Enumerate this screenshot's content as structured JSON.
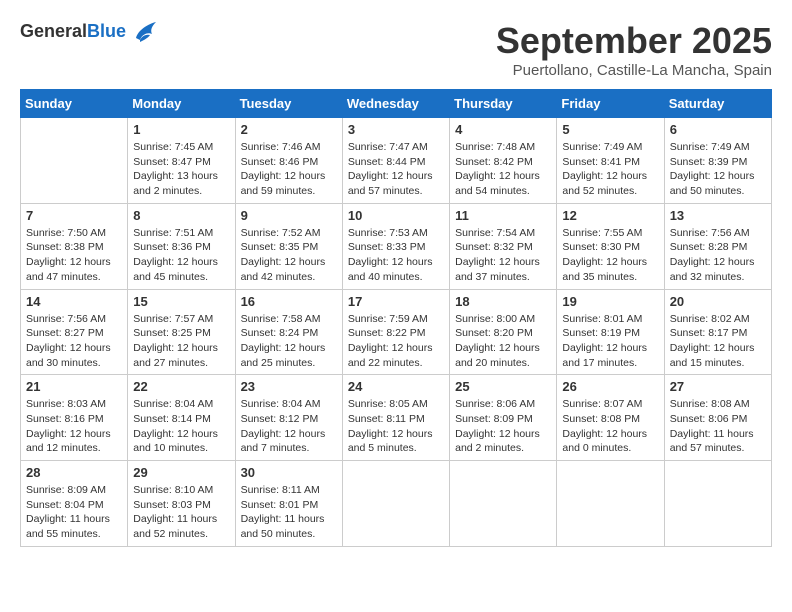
{
  "logo": {
    "general": "General",
    "blue": "Blue",
    "bird_icon": "▶"
  },
  "title": "September 2025",
  "subtitle": "Puertollano, Castille-La Mancha, Spain",
  "days_of_week": [
    "Sunday",
    "Monday",
    "Tuesday",
    "Wednesday",
    "Thursday",
    "Friday",
    "Saturday"
  ],
  "weeks": [
    [
      {
        "day": "",
        "info": ""
      },
      {
        "day": "1",
        "info": "Sunrise: 7:45 AM\nSunset: 8:47 PM\nDaylight: 13 hours\nand 2 minutes."
      },
      {
        "day": "2",
        "info": "Sunrise: 7:46 AM\nSunset: 8:46 PM\nDaylight: 12 hours\nand 59 minutes."
      },
      {
        "day": "3",
        "info": "Sunrise: 7:47 AM\nSunset: 8:44 PM\nDaylight: 12 hours\nand 57 minutes."
      },
      {
        "day": "4",
        "info": "Sunrise: 7:48 AM\nSunset: 8:42 PM\nDaylight: 12 hours\nand 54 minutes."
      },
      {
        "day": "5",
        "info": "Sunrise: 7:49 AM\nSunset: 8:41 PM\nDaylight: 12 hours\nand 52 minutes."
      },
      {
        "day": "6",
        "info": "Sunrise: 7:49 AM\nSunset: 8:39 PM\nDaylight: 12 hours\nand 50 minutes."
      }
    ],
    [
      {
        "day": "7",
        "info": "Sunrise: 7:50 AM\nSunset: 8:38 PM\nDaylight: 12 hours\nand 47 minutes."
      },
      {
        "day": "8",
        "info": "Sunrise: 7:51 AM\nSunset: 8:36 PM\nDaylight: 12 hours\nand 45 minutes."
      },
      {
        "day": "9",
        "info": "Sunrise: 7:52 AM\nSunset: 8:35 PM\nDaylight: 12 hours\nand 42 minutes."
      },
      {
        "day": "10",
        "info": "Sunrise: 7:53 AM\nSunset: 8:33 PM\nDaylight: 12 hours\nand 40 minutes."
      },
      {
        "day": "11",
        "info": "Sunrise: 7:54 AM\nSunset: 8:32 PM\nDaylight: 12 hours\nand 37 minutes."
      },
      {
        "day": "12",
        "info": "Sunrise: 7:55 AM\nSunset: 8:30 PM\nDaylight: 12 hours\nand 35 minutes."
      },
      {
        "day": "13",
        "info": "Sunrise: 7:56 AM\nSunset: 8:28 PM\nDaylight: 12 hours\nand 32 minutes."
      }
    ],
    [
      {
        "day": "14",
        "info": "Sunrise: 7:56 AM\nSunset: 8:27 PM\nDaylight: 12 hours\nand 30 minutes."
      },
      {
        "day": "15",
        "info": "Sunrise: 7:57 AM\nSunset: 8:25 PM\nDaylight: 12 hours\nand 27 minutes."
      },
      {
        "day": "16",
        "info": "Sunrise: 7:58 AM\nSunset: 8:24 PM\nDaylight: 12 hours\nand 25 minutes."
      },
      {
        "day": "17",
        "info": "Sunrise: 7:59 AM\nSunset: 8:22 PM\nDaylight: 12 hours\nand 22 minutes."
      },
      {
        "day": "18",
        "info": "Sunrise: 8:00 AM\nSunset: 8:20 PM\nDaylight: 12 hours\nand 20 minutes."
      },
      {
        "day": "19",
        "info": "Sunrise: 8:01 AM\nSunset: 8:19 PM\nDaylight: 12 hours\nand 17 minutes."
      },
      {
        "day": "20",
        "info": "Sunrise: 8:02 AM\nSunset: 8:17 PM\nDaylight: 12 hours\nand 15 minutes."
      }
    ],
    [
      {
        "day": "21",
        "info": "Sunrise: 8:03 AM\nSunset: 8:16 PM\nDaylight: 12 hours\nand 12 minutes."
      },
      {
        "day": "22",
        "info": "Sunrise: 8:04 AM\nSunset: 8:14 PM\nDaylight: 12 hours\nand 10 minutes."
      },
      {
        "day": "23",
        "info": "Sunrise: 8:04 AM\nSunset: 8:12 PM\nDaylight: 12 hours\nand 7 minutes."
      },
      {
        "day": "24",
        "info": "Sunrise: 8:05 AM\nSunset: 8:11 PM\nDaylight: 12 hours\nand 5 minutes."
      },
      {
        "day": "25",
        "info": "Sunrise: 8:06 AM\nSunset: 8:09 PM\nDaylight: 12 hours\nand 2 minutes."
      },
      {
        "day": "26",
        "info": "Sunrise: 8:07 AM\nSunset: 8:08 PM\nDaylight: 12 hours\nand 0 minutes."
      },
      {
        "day": "27",
        "info": "Sunrise: 8:08 AM\nSunset: 8:06 PM\nDaylight: 11 hours\nand 57 minutes."
      }
    ],
    [
      {
        "day": "28",
        "info": "Sunrise: 8:09 AM\nSunset: 8:04 PM\nDaylight: 11 hours\nand 55 minutes."
      },
      {
        "day": "29",
        "info": "Sunrise: 8:10 AM\nSunset: 8:03 PM\nDaylight: 11 hours\nand 52 minutes."
      },
      {
        "day": "30",
        "info": "Sunrise: 8:11 AM\nSunset: 8:01 PM\nDaylight: 11 hours\nand 50 minutes."
      },
      {
        "day": "",
        "info": ""
      },
      {
        "day": "",
        "info": ""
      },
      {
        "day": "",
        "info": ""
      },
      {
        "day": "",
        "info": ""
      }
    ]
  ]
}
